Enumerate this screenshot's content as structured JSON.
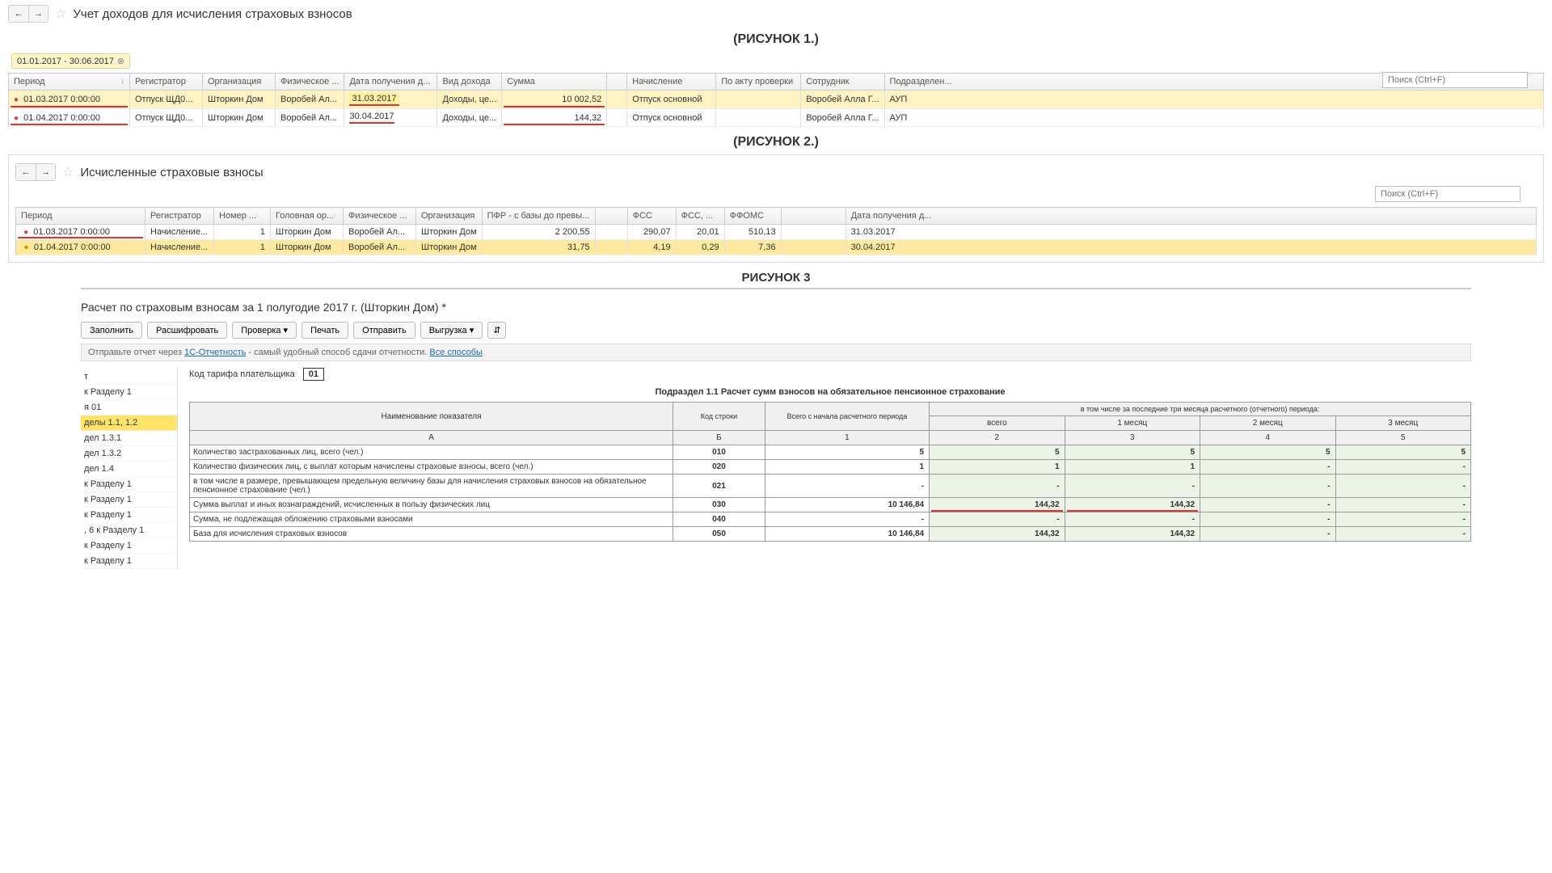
{
  "fig1": {
    "title": "Учет доходов для исчисления страховых взносов",
    "label": "(РИСУНОК 1.)",
    "search_placeholder": "Поиск (Ctrl+F)",
    "chip": "01.01.2017 - 30.06.2017",
    "columns": [
      "Период",
      "Регистратор",
      "Организация",
      "Физическое ...",
      "Дата получения д...",
      "Вид дохода",
      "Сумма",
      "Начисление",
      "По акту проверки",
      "Сотрудник",
      "Подразделен..."
    ],
    "rows": [
      {
        "period": "01.03.2017 0:00:00",
        "reg": "Отпуск ЩД0...",
        "org": "Шторкин Дом",
        "fiz": "Воробей Ал...",
        "date": "31.03.2017",
        "vid": "Доходы, це...",
        "sum": "10 002,52",
        "nach": "Отпуск основной",
        "akt": "",
        "sotr": "Воробей Алла Г...",
        "podr": "АУП",
        "hl": true
      },
      {
        "period": "01.04.2017 0:00:00",
        "reg": "Отпуск ЩД0...",
        "org": "Шторкин Дом",
        "fiz": "Воробей Ал...",
        "date": "30.04.2017",
        "vid": "Доходы, це...",
        "sum": "144,32",
        "nach": "Отпуск основной",
        "akt": "",
        "sotr": "Воробей Алла Г...",
        "podr": "АУП",
        "hl": false
      }
    ]
  },
  "fig2": {
    "title": "Исчисленные страховые взносы",
    "label": "(РИСУНОК 2.)",
    "search_placeholder": "Поиск (Ctrl+F)",
    "columns": [
      "Период",
      "Регистратор",
      "Номер ...",
      "Головная ор...",
      "Физическое ...",
      "Организация",
      "ПФР - с базы до превы...",
      "",
      "ФСС",
      "ФСС, ...",
      "ФФОМС",
      "",
      "Дата получения д..."
    ],
    "rows": [
      {
        "period": "01.03.2017 0:00:00",
        "reg": "Начисление...",
        "num": "1",
        "golov": "Шторкин Дом",
        "fiz": "Воробей Ал...",
        "org": "Шторкин Дом",
        "pfr": "2 200,55",
        "c8": "",
        "fss": "290,07",
        "fssd": "20,01",
        "ffoms": "510,13",
        "c12": "",
        "date": "31.03.2017",
        "hl": false
      },
      {
        "period": "01.04.2017 0:00:00",
        "reg": "Начисление...",
        "num": "1",
        "golov": "Шторкин Дом",
        "fiz": "Воробей Ал...",
        "org": "Шторкин Дом",
        "pfr": "31,75",
        "c8": "",
        "fss": "4,19",
        "fssd": "0,29",
        "ffoms": "7,36",
        "c12": "",
        "date": "30.04.2017",
        "hl": true
      }
    ]
  },
  "fig3": {
    "heading": "РИСУНОК 3",
    "report_title": "Расчет по страховым взносам за 1 полугодие 2017 г. (Шторкин Дом) *",
    "buttons": [
      "Заполнить",
      "Расшифровать",
      "Проверка ▾",
      "Печать",
      "Отправить",
      "Выгрузка ▾"
    ],
    "attach": "⇵",
    "hint_pre": "Отправьте отчет через ",
    "hint_link1": "1С-Отчетность",
    "hint_mid": " - самый удобный способ сдачи отчетности. ",
    "hint_link2": "Все способы",
    "tree": [
      "т",
      "к Разделу 1",
      "я 01",
      "делы 1.1, 1.2",
      "дел 1.3.1",
      "дел 1.3.2",
      "дел 1.4",
      "к Разделу 1",
      "к Разделу 1",
      "к Разделу 1",
      ", 6 к Разделу 1",
      "к Разделу 1",
      "к Разделу 1"
    ],
    "tree_hl_index": 3,
    "tarif_label": "Код тарифа плательщика",
    "tarif_value": "01",
    "subhead": "Подраздел 1.1 Расчет сумм взносов на обязательное пенсионное страхование",
    "h": {
      "name": "Наименование показателя",
      "code": "Код строки",
      "total": "Всего с начала расчетного периода",
      "group": "в том числе за последние три месяца расчетного (отчетного) периода:",
      "c1": "всего",
      "c2": "1 месяц",
      "c3": "2 месяц",
      "c4": "3 месяц",
      "ra": "А",
      "rb": "Б",
      "r1": "1",
      "r2": "2",
      "r3": "3",
      "r4": "4",
      "r5": "5"
    },
    "rows": [
      {
        "name": "Количество застрахованных лиц, всего (чел.)",
        "code": "010",
        "v": [
          "5",
          "5",
          "5",
          "5",
          "5"
        ]
      },
      {
        "name": "Количество физических лиц, с выплат которым начислены страховые взносы, всего (чел.)",
        "code": "020",
        "v": [
          "1",
          "1",
          "1",
          "-",
          "-"
        ]
      },
      {
        "name": "   в том числе в размере, превышающем предельную величину базы для начисления страховых взносов на обязательное пенсионное страхование (чел.)",
        "code": "021",
        "v": [
          "-",
          "-",
          "-",
          "-",
          "-"
        ]
      },
      {
        "name": "Сумма выплат и иных вознаграждений, исчисленных в пользу физических лиц",
        "code": "030",
        "v": [
          "10 146,84",
          "144,32",
          "144,32",
          "-",
          "-"
        ],
        "red": [
          1,
          2
        ]
      },
      {
        "name": "Сумма, не подлежащая обложению страховыми взносами",
        "code": "040",
        "v": [
          "-",
          "-",
          "-",
          "-",
          "-"
        ]
      },
      {
        "name": "База для исчисления страховых взносов",
        "code": "050",
        "v": [
          "10 146,84",
          "144,32",
          "144,32",
          "-",
          "-"
        ]
      }
    ]
  }
}
